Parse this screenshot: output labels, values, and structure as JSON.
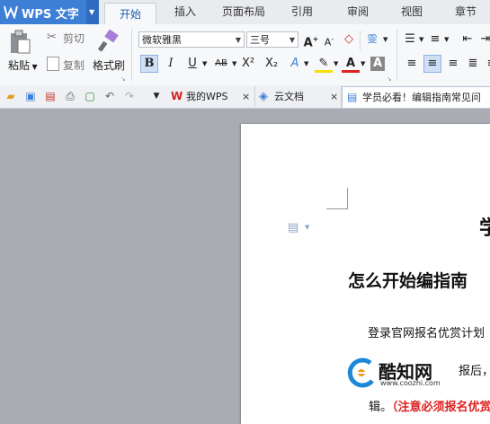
{
  "app": {
    "name": "WPS 文字"
  },
  "tabs": [
    {
      "label": "开始",
      "active": true
    },
    {
      "label": "插入"
    },
    {
      "label": "页面布局"
    },
    {
      "label": "引用"
    },
    {
      "label": "审阅"
    },
    {
      "label": "视图"
    },
    {
      "label": "章节"
    }
  ],
  "ribbon": {
    "paste": "粘贴",
    "cut": "剪切",
    "copy": "复制",
    "format_painter": "格式刷",
    "font_name": "微软雅黑",
    "font_size": "三号",
    "bold": "B",
    "italic": "I",
    "underline": "U",
    "strike": "AB",
    "superscript": "X²",
    "subscript": "X₂"
  },
  "doc_tabs": [
    {
      "label": "我的WPS"
    },
    {
      "label": "云文档"
    },
    {
      "label": "学员必看！编辑指南常见问"
    }
  ],
  "document": {
    "heading_partial": "学",
    "subheading": "怎么开始编指南",
    "line1": "登录官网报名优赏计划",
    "line2_partial": "报后，",
    "line3_prefix": "辑。",
    "line3_red": "（注意必须报名优赏"
  },
  "watermark": {
    "name": "酷知网",
    "url": "www.coozhi.com"
  },
  "colors": {
    "accent": "#3e7fd6",
    "red_text": "#e02020"
  }
}
